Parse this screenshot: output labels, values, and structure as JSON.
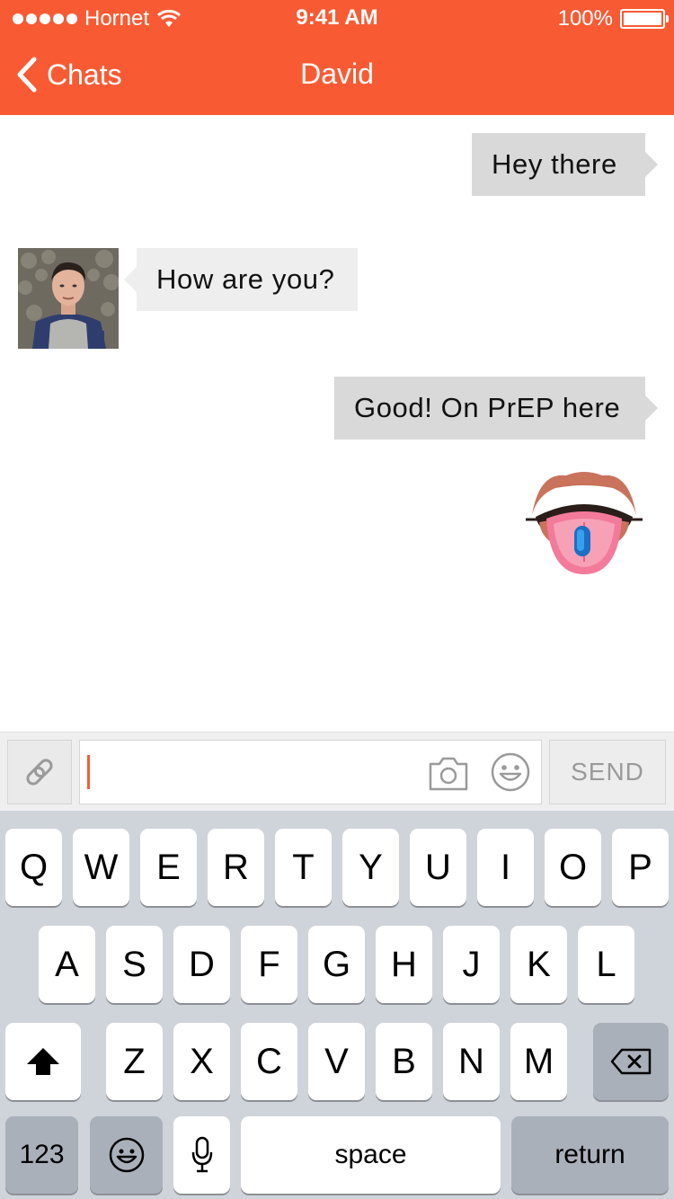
{
  "status_bar": {
    "carrier": "Hornet",
    "time": "9:41 AM",
    "battery": "100%"
  },
  "nav": {
    "back_label": "Chats",
    "title": "David"
  },
  "messages": [
    {
      "direction": "outgoing",
      "text": "Hey there"
    },
    {
      "direction": "incoming",
      "text": "How are you?"
    },
    {
      "direction": "outgoing",
      "text": "Good! On PrEP here"
    },
    {
      "direction": "outgoing",
      "sticker": "tongue-with-pill-sticker"
    }
  ],
  "composer": {
    "value": "",
    "send_label": "SEND"
  },
  "keyboard": {
    "row1": [
      "Q",
      "W",
      "E",
      "R",
      "T",
      "Y",
      "U",
      "I",
      "O",
      "P"
    ],
    "row2": [
      "A",
      "S",
      "D",
      "F",
      "G",
      "H",
      "J",
      "K",
      "L"
    ],
    "row3": [
      "Z",
      "X",
      "C",
      "V",
      "B",
      "N",
      "M"
    ],
    "numbers_label": "123",
    "space_label": "space",
    "return_label": "return"
  },
  "colors": {
    "accent": "#f85b34",
    "outgoing_bubble": "#d9d9d9",
    "incoming_bubble": "#eeeeee",
    "keyboard_bg": "#cfd3da"
  }
}
